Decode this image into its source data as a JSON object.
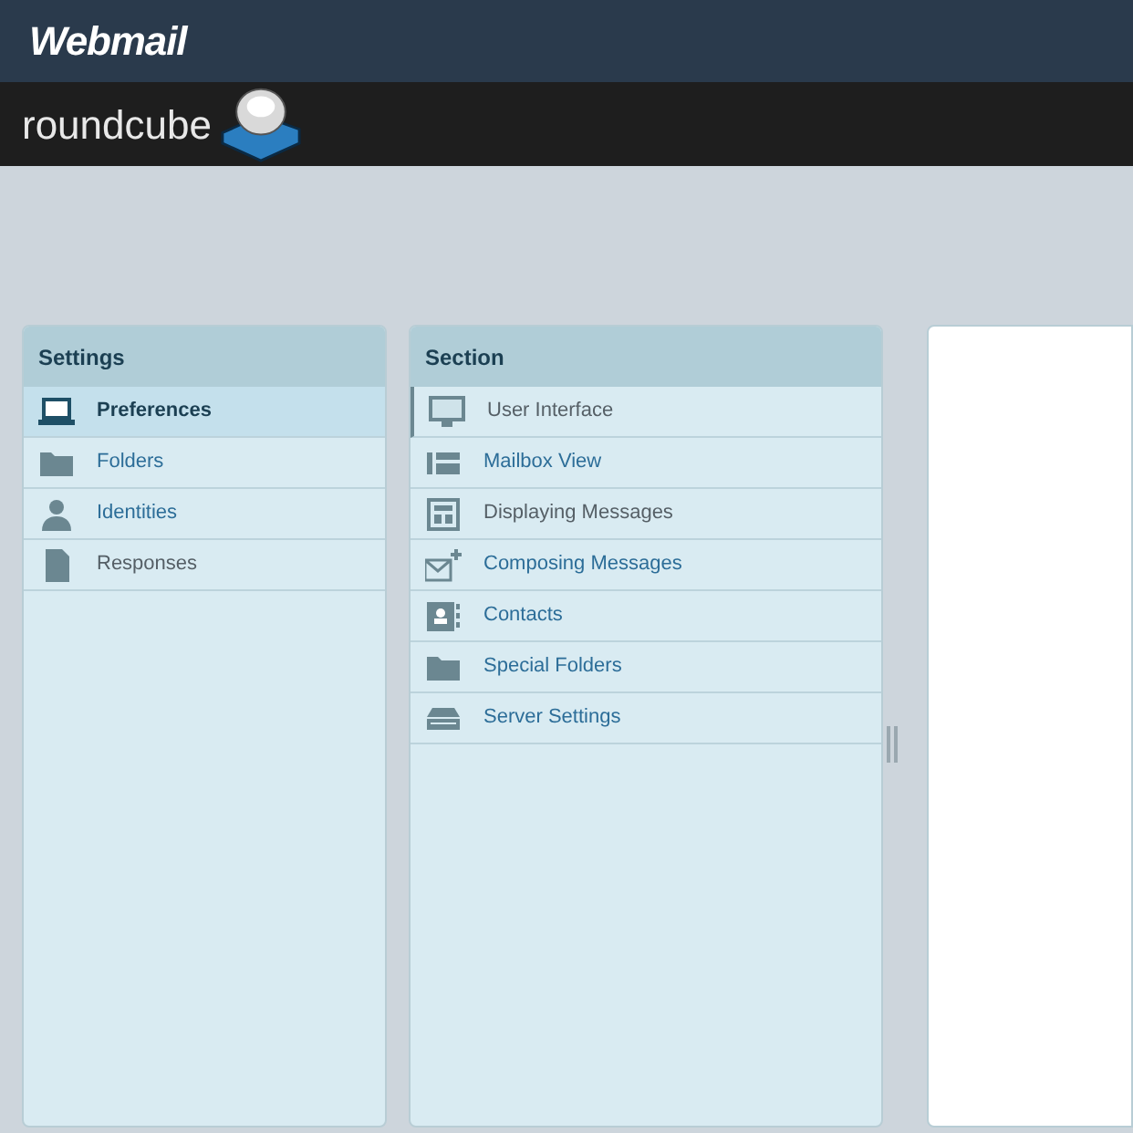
{
  "header": {
    "title": "Webmail"
  },
  "logo": {
    "text": "roundcube"
  },
  "settings": {
    "title": "Settings",
    "items": [
      {
        "label": "Preferences",
        "kind": "laptop",
        "selected": true,
        "visited": false
      },
      {
        "label": "Folders",
        "kind": "folder",
        "selected": false,
        "visited": false
      },
      {
        "label": "Identities",
        "kind": "person",
        "selected": false,
        "visited": false
      },
      {
        "label": "Responses",
        "kind": "document",
        "selected": false,
        "visited": true
      }
    ]
  },
  "section": {
    "title": "Section",
    "items": [
      {
        "label": "User Interface",
        "kind": "monitor",
        "selected": true,
        "visited": true
      },
      {
        "label": "Mailbox View",
        "kind": "layout",
        "selected": false,
        "visited": false
      },
      {
        "label": "Displaying Messages",
        "kind": "message",
        "selected": false,
        "visited": true
      },
      {
        "label": "Composing Messages",
        "kind": "compose",
        "selected": false,
        "visited": false
      },
      {
        "label": "Contacts",
        "kind": "contacts",
        "selected": false,
        "visited": false
      },
      {
        "label": "Special Folders",
        "kind": "folder",
        "selected": false,
        "visited": false
      },
      {
        "label": "Server Settings",
        "kind": "server",
        "selected": false,
        "visited": false
      }
    ]
  }
}
